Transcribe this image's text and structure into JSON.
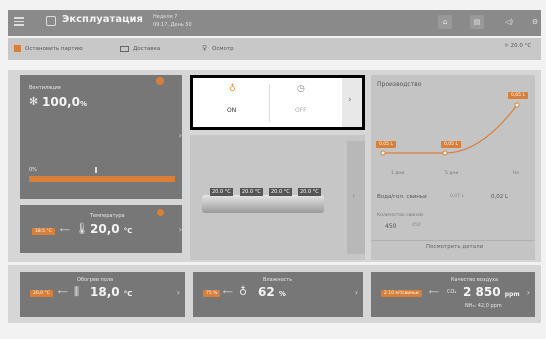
{
  "header": {
    "title": "Эксплуатация",
    "house": "Неделя 7",
    "date_time": "09:17, День 50"
  },
  "toolbar": {
    "stop_batch": "Остановить партию",
    "delivery": "Доставка",
    "inspection": "Осмотр",
    "outside_temp": "☼ 20.0 °C"
  },
  "ventilation": {
    "label": "Вентиляция",
    "value": "100,0",
    "unit": "%",
    "bar_min": "0%",
    "progress": 1.0
  },
  "temperature": {
    "label": "Температура",
    "setpoint": "18.5 °C",
    "value": "20,0",
    "unit": "°C"
  },
  "lighting": {
    "on_label": "ON",
    "off_label": "OFF"
  },
  "feeders": {
    "temps": [
      "20.0 °C",
      "20.0 °C",
      "20.0 °C",
      "20.0 °C"
    ]
  },
  "production": {
    "title": "Производство",
    "points": [
      "0,05 L",
      "0,05 L",
      "0,65 L"
    ],
    "x_labels": [
      "1 дни",
      "5 дни",
      "Не"
    ],
    "water_label": "Вода/гол. свиньи",
    "water_value1": "0,07 L",
    "water_value2": "0,02 L",
    "pigs_label": "Количество свиней",
    "pigs_value1": "450",
    "pigs_value2": "450",
    "details": "Посмотреть детали"
  },
  "floor_heating": {
    "label": "Обогрев пола",
    "setpoint": "20,0 °C",
    "value": "18,0",
    "unit": "°C"
  },
  "humidity": {
    "label": "Влажность",
    "setpoint": "75 %",
    "value": "62",
    "unit": "%"
  },
  "air_quality": {
    "label": "Качество воздуха",
    "badge": "2 10 м³/свиньи",
    "co2_label": "CO₂",
    "value": "2 850",
    "unit": "ppm",
    "nh3": "NH₃: 42,0 ppm"
  },
  "colors": {
    "accent": "#d87f3a",
    "panel": "#777777",
    "background": "#f2f2f2"
  }
}
